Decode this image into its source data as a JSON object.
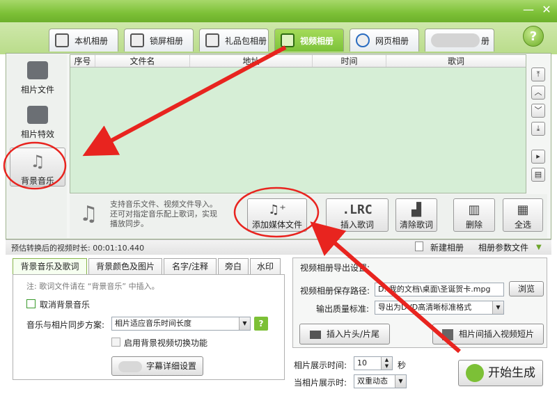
{
  "tabs": [
    {
      "label": "本机相册",
      "icon": "person-photo-icon",
      "active": false
    },
    {
      "label": "锁屏相册",
      "icon": "monitor-icon",
      "active": false
    },
    {
      "label": "礼品包相册",
      "icon": "gift-icon",
      "active": false
    },
    {
      "label": "视频相册",
      "icon": "film-icon",
      "active": true
    },
    {
      "label": "网页相册",
      "icon": "ie-icon",
      "active": false
    },
    {
      "label": "册",
      "icon": "blurred-icon",
      "active": false
    }
  ],
  "help_label": "?",
  "window_controls": {
    "minimize": "—",
    "close": "✕"
  },
  "sidebar": [
    {
      "label": "相片文件",
      "icon": "camera-icon",
      "active": false
    },
    {
      "label": "相片特效",
      "icon": "sparkle-icon",
      "active": false
    },
    {
      "label": "背景音乐",
      "icon": "music-note-icon",
      "active": true
    }
  ],
  "table": {
    "columns": [
      "序号",
      "文件名",
      "地址",
      "时间",
      "歌词"
    ]
  },
  "tip": {
    "line1": "支持音乐文件、视频文件导入。",
    "line2": "还可对指定音乐配上歌词，实现",
    "line3": "播放同步。"
  },
  "actions": {
    "add_media": "添加媒体文件",
    "add_media_icon": "♫⁺",
    "insert_lyrics": "插入歌词",
    "insert_lyrics_icon": ".LRC",
    "clear_lyrics": "清除歌词",
    "delete": "删除",
    "select_all": "全选"
  },
  "status": {
    "estimate_label": "预估转换后的视频时长: 00:01:10.440",
    "new_album": "新建相册",
    "album_params": "相册参数文件"
  },
  "bottom_tabs": [
    "背景音乐及歌词",
    "背景颜色及图片",
    "名字/注释",
    "旁白",
    "水印"
  ],
  "music_panel": {
    "note": "注: 歌词文件请在 “背景音乐” 中插入。",
    "cancel_music": "取消背景音乐",
    "sync_label": "音乐与相片同步方案:",
    "sync_value": "相片适应音乐时间长度",
    "enable_switch": "启用背景视频切换功能",
    "subtitle_button": "字幕详细设置"
  },
  "export": {
    "title": "视频相册导出设置:",
    "path_label": "视频相册保存路径:",
    "path_value": "D:\\我的文档\\桌面\\圣诞贺卡.mpg",
    "browse": "浏览",
    "quality_label": "输出质量标准:",
    "quality_value": "导出为DVD高清晰标准格式",
    "insert_head": "插入片头/片尾",
    "insert_clip": "相片间插入视频短片",
    "display_time_label": "相片展示时间:",
    "display_time_value": "10",
    "display_time_unit": "秒",
    "when_display_label": "当相片展示时:",
    "when_display_value": "双重动态",
    "start": "开始生成"
  },
  "colors": {
    "accent_green": "#7cc036",
    "annotation_red": "#e8241f",
    "table_bg": "#d6eed6"
  }
}
